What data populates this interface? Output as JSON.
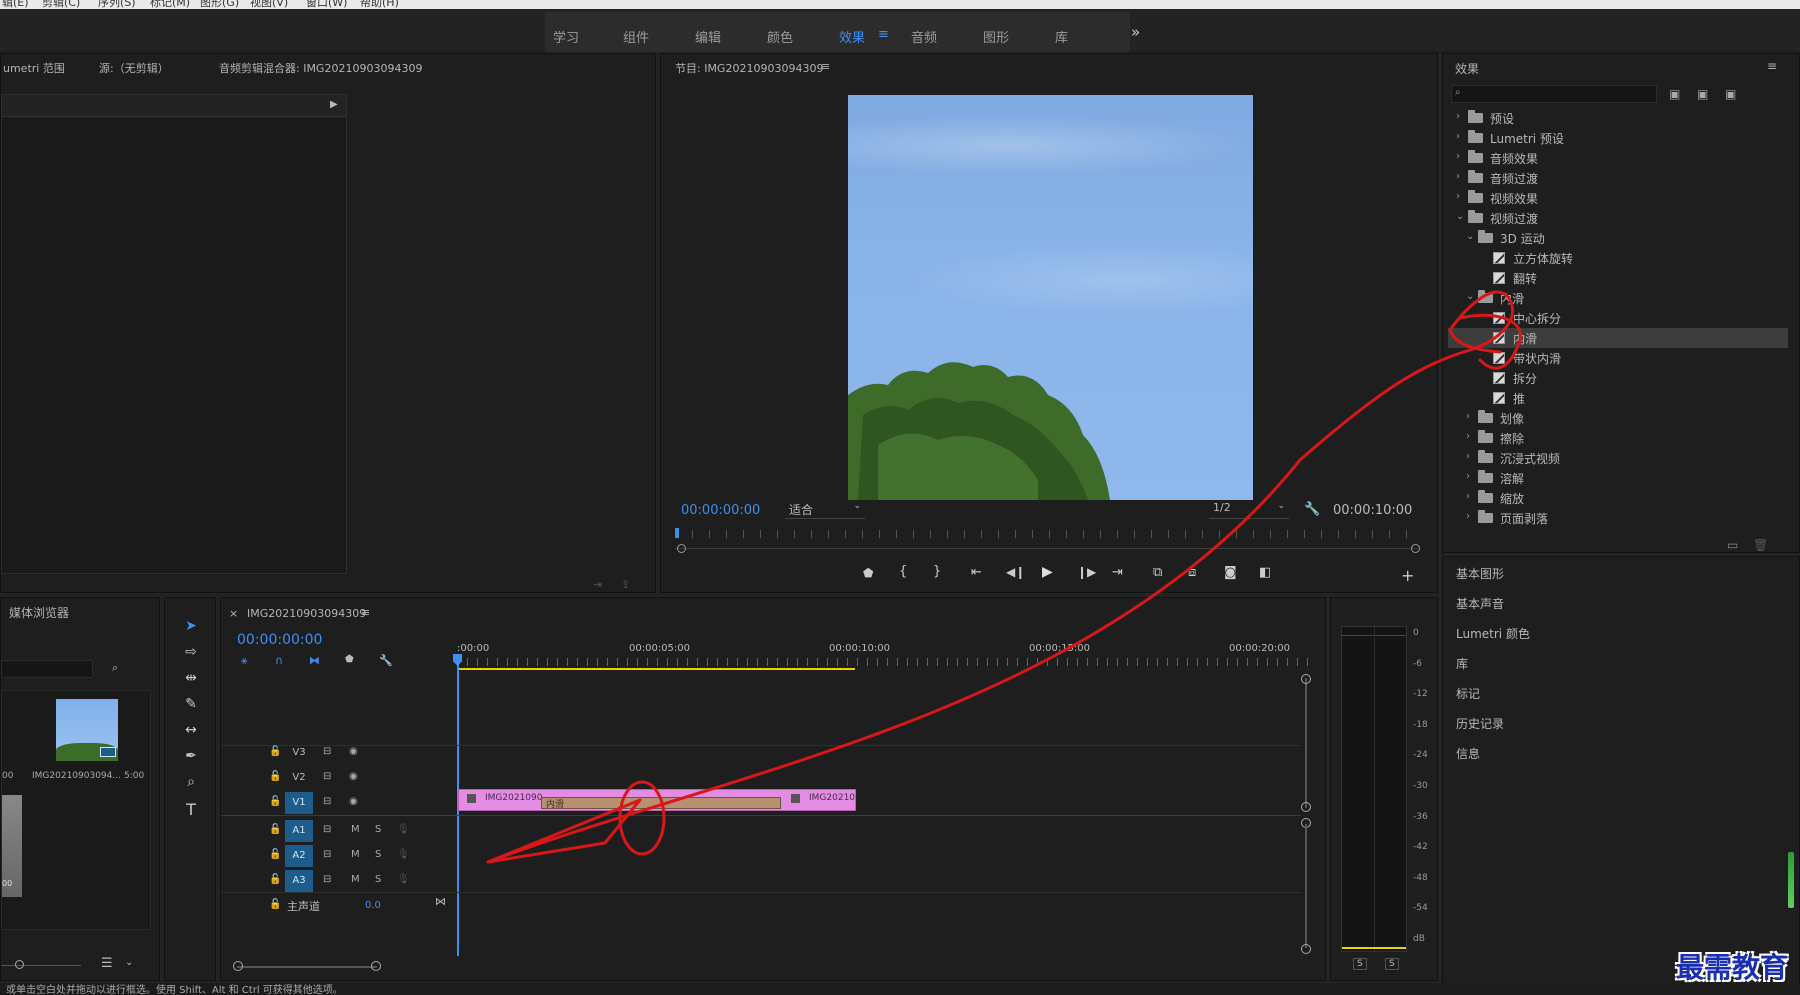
{
  "menubar": {
    "items": [
      "辑(E)",
      "剪辑(C)",
      "序列(S)",
      "标记(M)",
      "图形(G)",
      "视图(V)",
      "窗口(W)",
      "帮助(H)"
    ]
  },
  "workspace": {
    "tabs": [
      "学习",
      "组件",
      "编辑",
      "颜色",
      "效果",
      "音频",
      "图形",
      "库"
    ],
    "active": "效果",
    "menu_icon": "≡",
    "more": "»"
  },
  "source_panel": {
    "tabs": [
      "umetri 范围",
      "源:（无剪辑）",
      "音频剪辑混合器: IMG20210903094309"
    ]
  },
  "program": {
    "title": "节目: IMG20210903094309",
    "menu_icon": "≡",
    "timecode": "00:00:00:00",
    "fit": "适合",
    "resolution": "1/2",
    "duration": "00:00:10:00"
  },
  "effects": {
    "title": "效果",
    "search_placeholder": "",
    "tree": [
      {
        "label": "预设",
        "level": 0,
        "type": "folder-special",
        "open": false
      },
      {
        "label": "Lumetri 预设",
        "level": 0,
        "type": "folder-special",
        "open": false
      },
      {
        "label": "音频效果",
        "level": 0,
        "type": "folder",
        "open": false
      },
      {
        "label": "音频过渡",
        "level": 0,
        "type": "folder",
        "open": false
      },
      {
        "label": "视频效果",
        "level": 0,
        "type": "folder",
        "open": false
      },
      {
        "label": "视频过渡",
        "level": 0,
        "type": "folder",
        "open": true
      },
      {
        "label": "3D 运动",
        "level": 1,
        "type": "folder",
        "open": true
      },
      {
        "label": "立方体旋转",
        "level": 2,
        "type": "fx"
      },
      {
        "label": "翻转",
        "level": 2,
        "type": "fx"
      },
      {
        "label": "内滑",
        "level": 1,
        "type": "folder",
        "open": true
      },
      {
        "label": "中心拆分",
        "level": 2,
        "type": "fx"
      },
      {
        "label": "内滑",
        "level": 2,
        "type": "fx",
        "selected": true
      },
      {
        "label": "带状内滑",
        "level": 2,
        "type": "fx"
      },
      {
        "label": "拆分",
        "level": 2,
        "type": "fx"
      },
      {
        "label": "推",
        "level": 2,
        "type": "fx"
      },
      {
        "label": "划像",
        "level": 1,
        "type": "folder",
        "open": false
      },
      {
        "label": "擦除",
        "level": 1,
        "type": "folder",
        "open": false
      },
      {
        "label": "沉浸式视频",
        "level": 1,
        "type": "folder",
        "open": false
      },
      {
        "label": "溶解",
        "level": 1,
        "type": "folder",
        "open": false
      },
      {
        "label": "缩放",
        "level": 1,
        "type": "folder",
        "open": false
      },
      {
        "label": "页面剥落",
        "level": 1,
        "type": "folder",
        "open": false
      }
    ],
    "side_panels": [
      "基本图形",
      "基本声音",
      "Lumetri 颜色",
      "库",
      "标记",
      "历史记录",
      "信息"
    ]
  },
  "project": {
    "title": "媒体浏览器",
    "clip_name": "IMG20210903094...",
    "clip_dur": "5:00",
    "left_dur": "00",
    "left_dur2": "00"
  },
  "timeline": {
    "tab": "IMG20210903094309",
    "close": "×",
    "menu_icon": "≡",
    "timecode": "00:00:00:00",
    "ruler": [
      ":00:00",
      "00:00:05:00",
      "00:00:10:00",
      "00:00:15:00",
      "00:00:20:00"
    ],
    "video_tracks": [
      "V3",
      "V2",
      "V1"
    ],
    "audio_tracks": [
      "A1",
      "A2",
      "A3"
    ],
    "master_label": "主声道",
    "master_value": "0.0",
    "clip_left": "IMG2021090",
    "clip_transition": "内滑",
    "clip_right": "IMG20210",
    "m": "M",
    "s": "S"
  },
  "meter": {
    "scale": [
      "0",
      "-6",
      "-12",
      "-18",
      "-24",
      "-30",
      "-36",
      "-42",
      "-48",
      "-54",
      "dB"
    ],
    "solo": [
      "S",
      "S"
    ]
  },
  "statusbar": {
    "text": "或单击空白处并拖动以进行框选。使用 Shift、Alt 和 Ctrl 可获得其他选项。"
  },
  "watermark": {
    "text": "最需教育"
  },
  "colors": {
    "accent": "#3f8ff0",
    "clip": "#e28ce2",
    "transition": "#b89070",
    "annotation": "#d81818"
  }
}
